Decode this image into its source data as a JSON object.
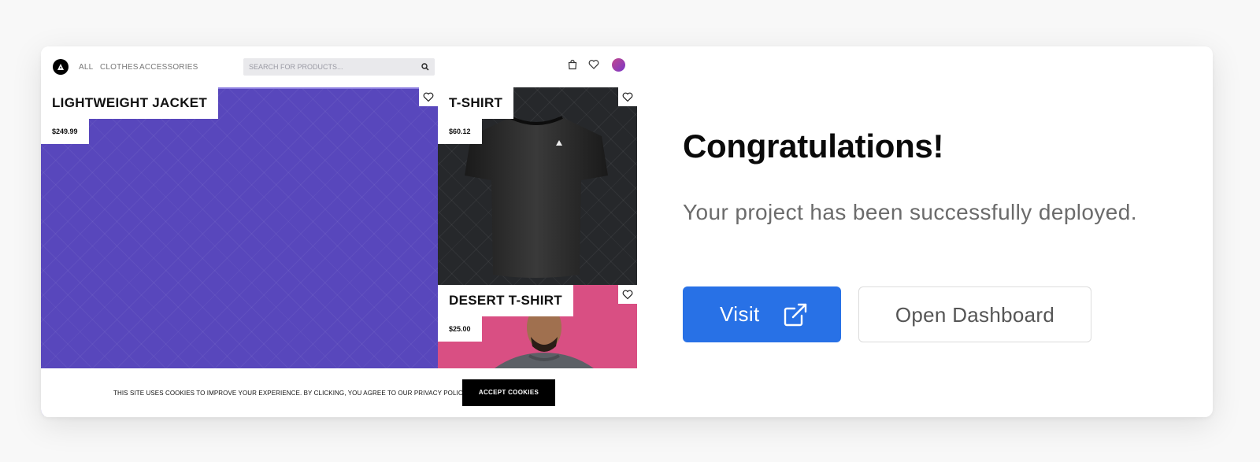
{
  "store": {
    "nav": {
      "links": [
        "ALL",
        "CLOTHES",
        "ACCESSORIES"
      ],
      "search_placeholder": "SEARCH FOR PRODUCTS..."
    },
    "products": [
      {
        "title": "LIGHTWEIGHT JACKET",
        "price": "$249.99",
        "bg": "#5847bc"
      },
      {
        "title": "T-SHIRT",
        "price": "$60.12",
        "bg": "#26282b"
      },
      {
        "title": "DESERT T-SHIRT",
        "price": "$25.00",
        "bg": "#d94f83"
      }
    ],
    "cookie": {
      "message": "THIS SITE USES COOKIES TO IMPROVE YOUR EXPERIENCE. BY CLICKING, YOU AGREE TO OUR PRIVACY POLICY.",
      "accept_label": "ACCEPT COOKIES"
    }
  },
  "panel": {
    "headline": "Congratulations!",
    "subtitle": "Your project has been successfully deployed.",
    "visit_label": "Visit",
    "dashboard_label": "Open Dashboard"
  },
  "colors": {
    "accent": "#2871e6",
    "page_background": "#f8f8f8"
  },
  "icons": [
    "store-logo-icon",
    "search-icon",
    "cart-icon",
    "heart-icon",
    "external-link-icon"
  ]
}
